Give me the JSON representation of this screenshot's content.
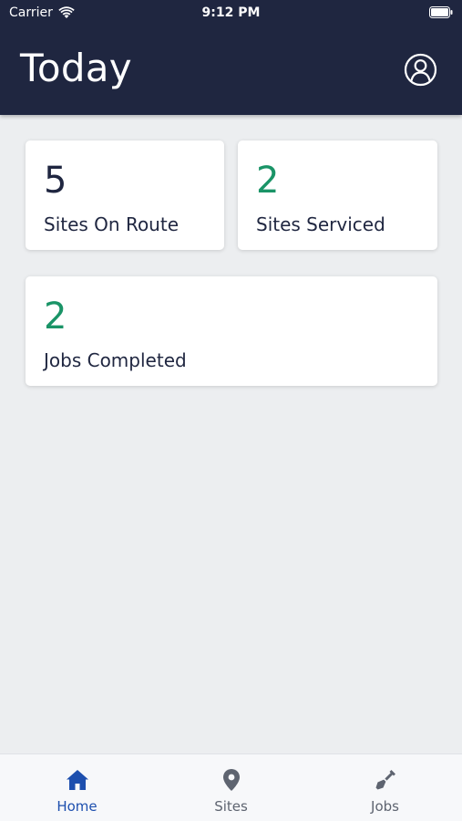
{
  "status_bar": {
    "carrier": "Carrier",
    "time": "9:12 PM"
  },
  "header": {
    "title": "Today"
  },
  "cards": {
    "route": {
      "value": "5",
      "label": "Sites On Route"
    },
    "serviced": {
      "value": "2",
      "label": "Sites Serviced"
    },
    "jobs": {
      "value": "2",
      "label": "Jobs Completed"
    }
  },
  "tabs": [
    {
      "label": "Home",
      "icon": "home-icon",
      "active": true
    },
    {
      "label": "Sites",
      "icon": "map-pin-icon",
      "active": false
    },
    {
      "label": "Jobs",
      "icon": "shovel-icon",
      "active": false
    }
  ],
  "colors": {
    "header_bg": "#1f2640",
    "accent_blue": "#1d4fae",
    "value_green": "#1a9467",
    "background": "#eceef0"
  }
}
